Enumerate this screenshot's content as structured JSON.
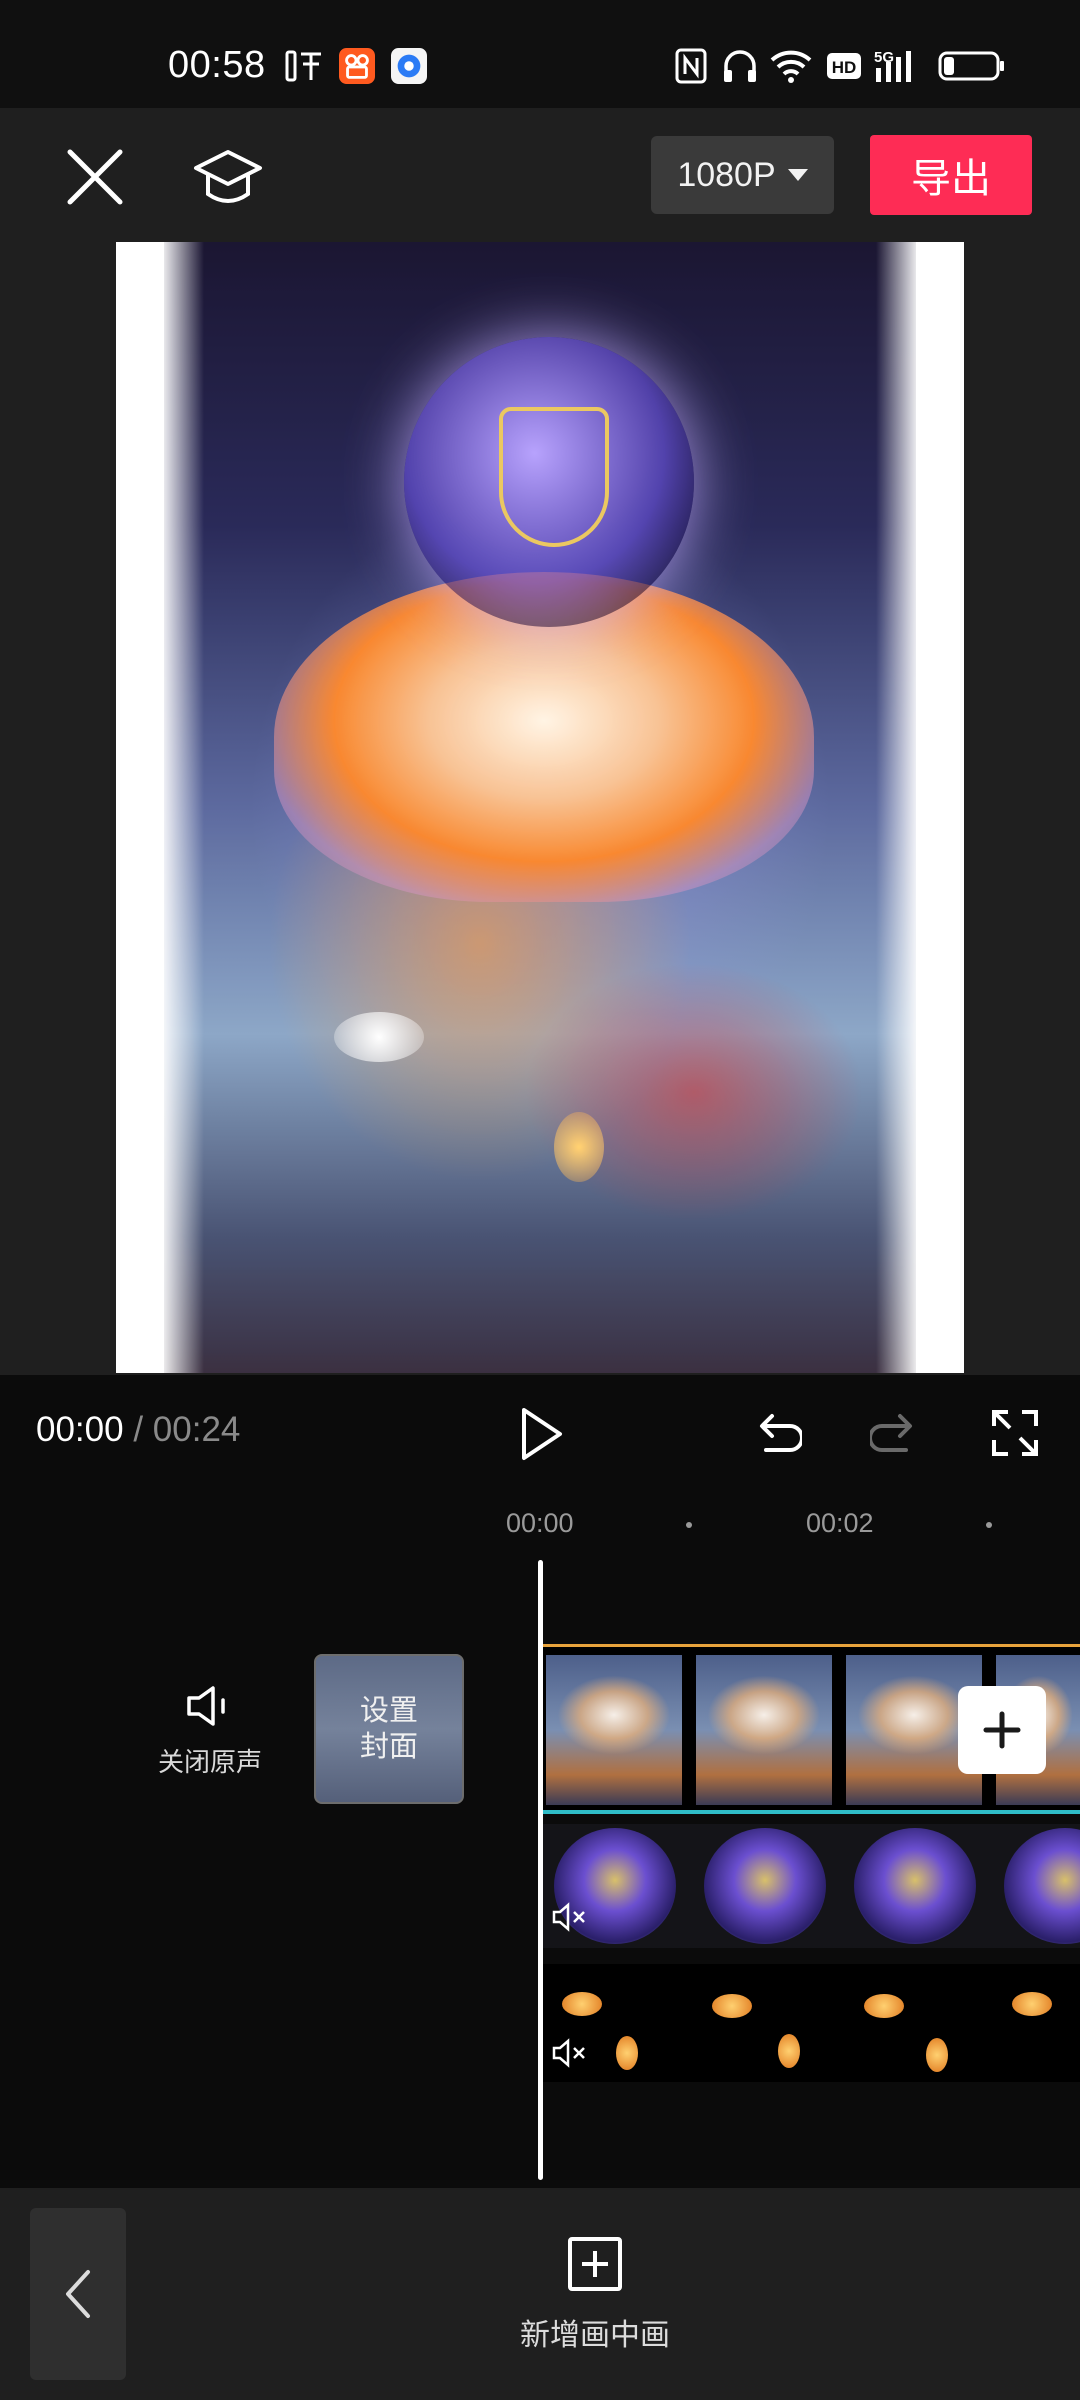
{
  "status_bar": {
    "time": "00:58",
    "left_icons": [
      "listen-app-icon",
      "kuaishou-app-icon",
      "browser-app-icon"
    ],
    "right_icons": [
      "nfc-icon",
      "headphones-icon",
      "wifi-icon",
      "hd-icon",
      "signal-5g-icon",
      "battery-icon"
    ],
    "hd_text": "HD",
    "network_text": "5G"
  },
  "toolbar": {
    "close_icon": "close-icon",
    "tutorial_icon": "graduation-cap-icon",
    "resolution_label": "1080P",
    "export_label": "导出",
    "export_color": "#fe2c55"
  },
  "playback": {
    "current_time": "00:00",
    "separator": "/",
    "total_time": "00:24",
    "icons": [
      "play-icon",
      "undo-icon",
      "redo-icon",
      "fullscreen-icon"
    ]
  },
  "timeline": {
    "ruler_labels": [
      "00:00",
      "00:02"
    ],
    "mute_label": "关闭原声",
    "cover_label_line1": "设置",
    "cover_label_line2": "封面",
    "main_track_color_top": "#e8a33c",
    "main_track_color_bottom": "#2fbcc7"
  },
  "bottom_bar": {
    "back_icon": "chevron-left-icon",
    "pip_label": "新增画中画",
    "pip_icon": "add-square-icon"
  }
}
